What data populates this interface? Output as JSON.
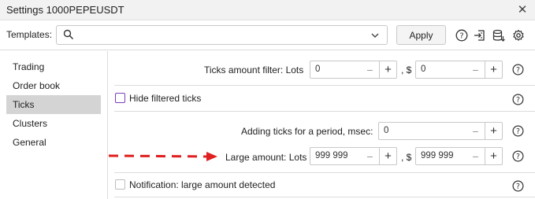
{
  "window": {
    "title": "Settings 1000PEPEUSDT"
  },
  "templates": {
    "label": "Templates:",
    "search_value": "",
    "apply_label": "Apply"
  },
  "sidebar": {
    "items": [
      {
        "label": "Trading",
        "active": false
      },
      {
        "label": "Order book",
        "active": false
      },
      {
        "label": "Ticks",
        "active": true
      },
      {
        "label": "Clusters",
        "active": false
      },
      {
        "label": "General",
        "active": false
      }
    ]
  },
  "settings": {
    "ticks_filter": {
      "label": "Ticks amount filter: Lots",
      "lots_value": "0",
      "sep": ", $",
      "usd_value": "0"
    },
    "hide_filtered": {
      "label": "Hide filtered ticks",
      "checked": false
    },
    "adding_ticks": {
      "label": "Adding ticks for a period, msec:",
      "value": "0"
    },
    "large_amount": {
      "label": "Large amount: Lots",
      "lots_value": "999 999",
      "sep": ", $",
      "usd_value": "999 999"
    },
    "notification": {
      "label": "Notification: large amount detected",
      "checked": false
    }
  },
  "colors": {
    "annotation_arrow": "#e02020",
    "active_tab_bg": "#d4d4d4",
    "checkbox_focus": "#7b3fb8"
  }
}
